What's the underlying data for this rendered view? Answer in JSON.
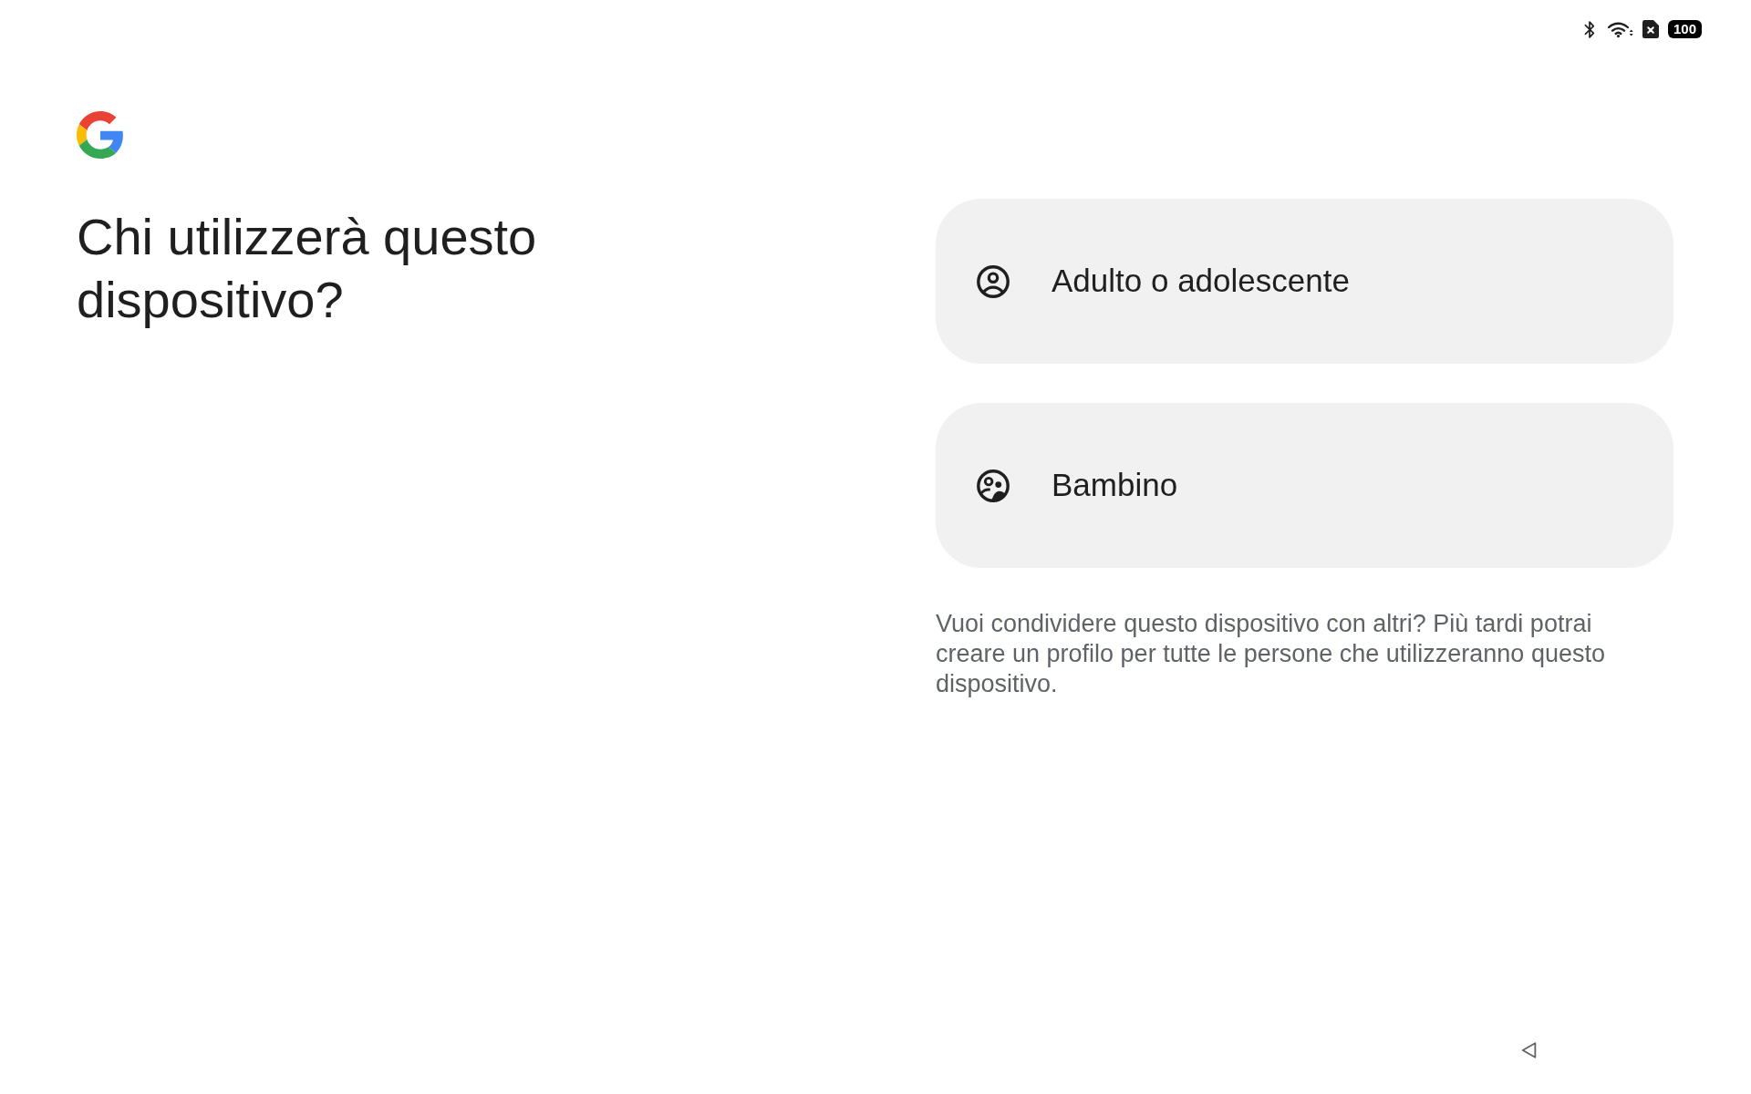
{
  "status_bar": {
    "battery": "100"
  },
  "title": "Chi utilizzerà questo dispositivo?",
  "options": [
    {
      "kind": "adult",
      "label": "Adulto o adolescente"
    },
    {
      "kind": "child",
      "label": "Bambino"
    }
  ],
  "note": "Vuoi condividere questo dispositivo con altri? Più tardi potrai creare un profilo per tutte le persone che utilizzeranno questo dispositivo."
}
